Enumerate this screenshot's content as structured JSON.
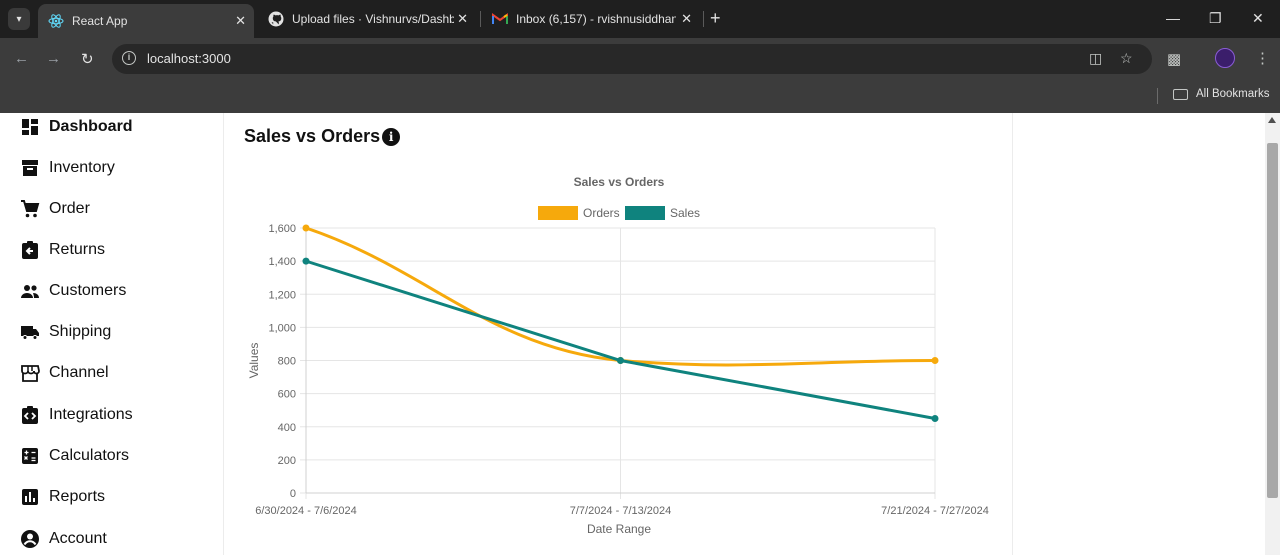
{
  "browser": {
    "tabs": [
      {
        "title": "React App",
        "icon": "react-icon",
        "active": true
      },
      {
        "title": "Upload files · Vishnurvs/Dashbo",
        "icon": "github-icon",
        "active": false
      },
      {
        "title": "Inbox (6,157) - rvishnusiddhan",
        "icon": "gmail-icon",
        "active": false
      }
    ],
    "address": "localhost:3000",
    "bookmarks_label": "All Bookmarks"
  },
  "sidebar": {
    "items": [
      {
        "label": "Dashboard",
        "icon": "dashboard-icon",
        "active": true
      },
      {
        "label": "Inventory",
        "icon": "inventory-icon",
        "active": false
      },
      {
        "label": "Order",
        "icon": "cart-icon",
        "active": false
      },
      {
        "label": "Returns",
        "icon": "returns-icon",
        "active": false
      },
      {
        "label": "Customers",
        "icon": "people-icon",
        "active": false
      },
      {
        "label": "Shipping",
        "icon": "truck-icon",
        "active": false
      },
      {
        "label": "Channel",
        "icon": "store-icon",
        "active": false
      },
      {
        "label": "Integrations",
        "icon": "integrations-icon",
        "active": false
      },
      {
        "label": "Calculators",
        "icon": "calculator-icon",
        "active": false
      },
      {
        "label": "Reports",
        "icon": "reports-icon",
        "active": false
      },
      {
        "label": "Account",
        "icon": "account-icon",
        "active": false
      }
    ]
  },
  "main": {
    "section_title": "Sales vs Orders",
    "info_glyph": "i"
  },
  "colors": {
    "orders": "#f6a90c",
    "sales": "#0f837e",
    "grid": "#e5e5e5",
    "axis_text": "#666666"
  },
  "chart_data": {
    "type": "line",
    "title": "Sales vs Orders",
    "categories": [
      "6/30/2024 - 7/6/2024",
      "7/7/2024 - 7/13/2024",
      "7/21/2024 - 7/27/2024"
    ],
    "series": [
      {
        "name": "Orders",
        "values": [
          1600,
          800,
          800
        ]
      },
      {
        "name": "Sales",
        "values": [
          1400,
          800,
          450
        ]
      }
    ],
    "xlabel": "Date Range",
    "ylabel": "Values",
    "ylim": [
      0,
      1600
    ],
    "yticks": [
      0,
      200,
      400,
      600,
      800,
      1000,
      1200,
      1400,
      1600
    ],
    "grid": true,
    "legend_position": "top"
  }
}
